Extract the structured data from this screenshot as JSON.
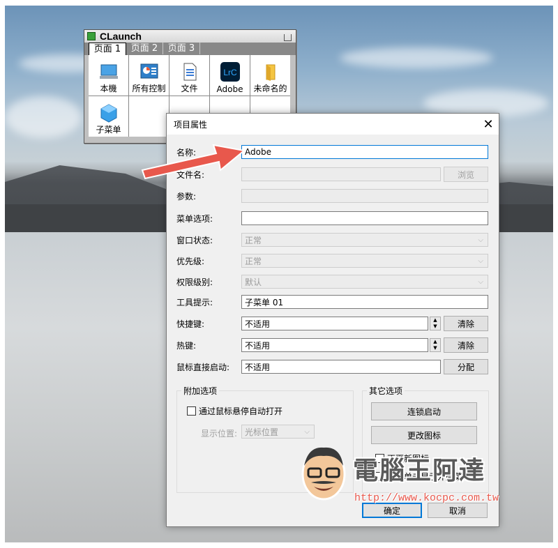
{
  "claunch": {
    "title": "CLaunch",
    "tabs": [
      "页面 1",
      "页面 2",
      "页面 3"
    ],
    "items": [
      {
        "label": "本機",
        "icon": "computer-icon"
      },
      {
        "label": "所有控制",
        "icon": "control-panel-icon"
      },
      {
        "label": "文件",
        "icon": "document-icon"
      },
      {
        "label": "Adobe",
        "icon": "lightroom-classic-icon",
        "icon_text": "LrC"
      },
      {
        "label": "未命名的",
        "icon": "folder-icon"
      },
      {
        "label": "子菜单",
        "icon": "submenu-cube-icon"
      }
    ]
  },
  "dialog": {
    "title": "项目属性",
    "close_glyph": "✕",
    "fields": {
      "name": {
        "label": "名称:",
        "value": "Adobe"
      },
      "filename": {
        "label": "文件名:",
        "value": "",
        "browse": "浏览"
      },
      "params": {
        "label": "参数:",
        "value": ""
      },
      "menu_option": {
        "label": "菜单选项:",
        "value": ""
      },
      "window_state": {
        "label": "窗口状态:",
        "value": "正常"
      },
      "priority": {
        "label": "优先级:",
        "value": "正常"
      },
      "permission": {
        "label": "权限级别:",
        "value": "默认"
      },
      "tooltip": {
        "label": "工具提示:",
        "value": "子菜单 01"
      },
      "shortcut": {
        "label": "快捷键:",
        "value": "不适用",
        "clear": "清除"
      },
      "hotkey": {
        "label": "热键:",
        "value": "不适用",
        "clear": "清除"
      },
      "mouse": {
        "label": "鼠标直接启动:",
        "value": "不适用",
        "assign": "分配"
      }
    },
    "extra": {
      "group_label": "附加选项",
      "hover_open": "通过鼠标悬停自动打开",
      "position_label": "显示位置:",
      "position_value": "光标位置"
    },
    "other": {
      "group_label": "其它选项",
      "chain_start": "连锁启动",
      "change_icon": "更改图标",
      "no_update_icon": "不更新图标",
      "right_click_menu": "右键单击显示外壳菜单"
    },
    "ok": "确定",
    "cancel": "取消"
  },
  "watermark": {
    "brand": "電腦王阿達",
    "url": "http://www.kocpc.com.tw"
  },
  "colors": {
    "accent": "#0078d7",
    "arrow": "#e8584c"
  }
}
